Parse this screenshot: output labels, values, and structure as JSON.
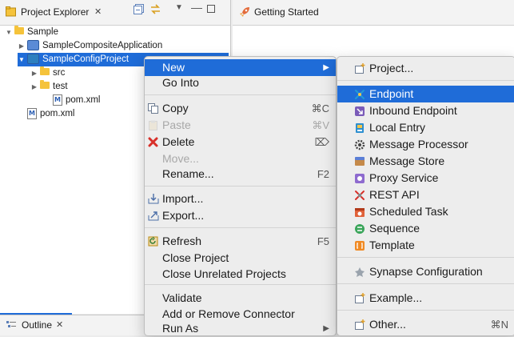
{
  "explorer": {
    "title": "Project Explorer",
    "tree": [
      {
        "label": "Sample",
        "indent": 0,
        "twisty": "▼",
        "icon": "folder-icon"
      },
      {
        "label": "SampleCompositeApplication",
        "indent": 1,
        "twisty": "▶",
        "icon": "composite-project-icon"
      },
      {
        "label": "SampleConfigProject",
        "indent": 1,
        "twisty": "▼",
        "icon": "config-project-icon",
        "selected": true
      },
      {
        "label": "src",
        "indent": 2,
        "twisty": "▶",
        "icon": "folder-icon"
      },
      {
        "label": "test",
        "indent": 2,
        "twisty": "▶",
        "icon": "folder-icon"
      },
      {
        "label": "pom.xml",
        "indent": 3,
        "twisty": "",
        "icon": "maven-pom-icon"
      },
      {
        "label": "pom.xml",
        "indent": 1,
        "twisty": "",
        "icon": "maven-pom-icon"
      }
    ]
  },
  "editor": {
    "tab_title": "Getting Started"
  },
  "outline": {
    "title": "Outline"
  },
  "context_menu": {
    "items": [
      {
        "label": "New",
        "submenu": true,
        "highlighted": true,
        "icon": ""
      },
      {
        "label": "Go Into",
        "icon": ""
      },
      {
        "label": "Copy",
        "shortcut": "⌘C",
        "icon": "copy-icon"
      },
      {
        "label": "Paste",
        "shortcut": "⌘V",
        "disabled": true,
        "icon": "paste-icon"
      },
      {
        "label": "Delete",
        "shortcut": "⌦",
        "icon": "delete-icon"
      },
      {
        "label": "Move...",
        "disabled": true,
        "icon": ""
      },
      {
        "label": "Rename...",
        "shortcut": "F2",
        "icon": ""
      },
      {
        "label": "Import...",
        "icon": "import-icon"
      },
      {
        "label": "Export...",
        "icon": "export-icon"
      },
      {
        "label": "Refresh",
        "shortcut": "F5",
        "icon": "refresh-icon"
      },
      {
        "label": "Close Project",
        "icon": ""
      },
      {
        "label": "Close Unrelated Projects",
        "icon": ""
      },
      {
        "label": "Validate",
        "icon": ""
      },
      {
        "label": "Add or Remove Connector",
        "icon": ""
      },
      {
        "label": "Run As",
        "submenu": true,
        "icon": ""
      }
    ]
  },
  "new_submenu": {
    "items": [
      {
        "label": "Project...",
        "icon": "new-project-icon"
      },
      {
        "label": "Endpoint",
        "highlighted": true,
        "icon": "endpoint-icon"
      },
      {
        "label": "Inbound Endpoint",
        "icon": "inbound-endpoint-icon"
      },
      {
        "label": "Local Entry",
        "icon": "local-entry-icon"
      },
      {
        "label": "Message Processor",
        "icon": "message-processor-icon"
      },
      {
        "label": "Message Store",
        "icon": "message-store-icon"
      },
      {
        "label": "Proxy Service",
        "icon": "proxy-service-icon"
      },
      {
        "label": "REST API",
        "icon": "rest-api-icon"
      },
      {
        "label": "Scheduled Task",
        "icon": "scheduled-task-icon"
      },
      {
        "label": "Sequence",
        "icon": "sequence-icon"
      },
      {
        "label": "Template",
        "icon": "template-icon"
      },
      {
        "label": "Synapse Configuration",
        "icon": "synapse-configuration-icon"
      },
      {
        "label": "Example...",
        "icon": "example-icon"
      },
      {
        "label": "Other...",
        "shortcut": "⌘N",
        "icon": "other-icon"
      }
    ]
  },
  "colors": {
    "selection": "#1f6cd8",
    "menu_bg": "#ededed",
    "folder": "#f5c33b"
  }
}
